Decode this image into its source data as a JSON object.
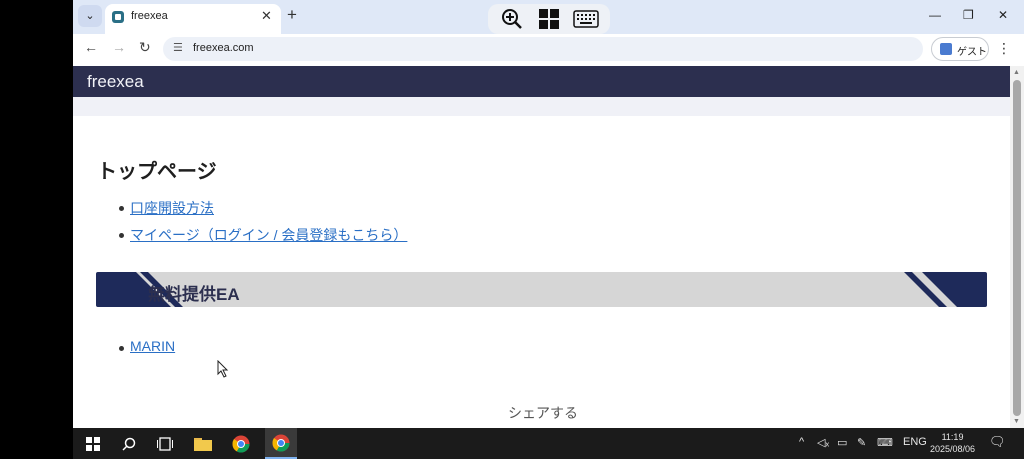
{
  "browser": {
    "tab_title": "freexea",
    "url": "freexea.com",
    "guest_label": "ゲスト"
  },
  "page": {
    "site_title": "freexea",
    "heading": "トップページ",
    "links": [
      "口座開設方法",
      "マイページ（ログイン / 会員登録もこちら）"
    ],
    "section_title": "無料提供EA",
    "section_links": [
      "MARIN"
    ],
    "share_label": "シェアする"
  },
  "taskbar": {
    "lang": "ENG",
    "time": "11:19",
    "date": "2025/08/06"
  },
  "colors": {
    "header_bg": "#2c2f4f",
    "link": "#2a6fc5",
    "banner_bg": "#d6d6d6",
    "banner_stripe": "#1e2a5a"
  }
}
